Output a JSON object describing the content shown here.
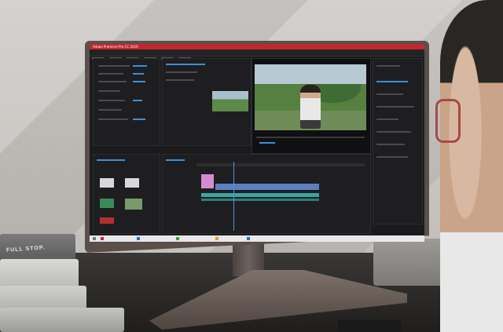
{
  "scene": {
    "description_label": "",
    "app": {
      "title": "Adobe Premiere Pro CC 2019",
      "panels": [
        "effects-controls",
        "source-monitor",
        "program-monitor",
        "effects-panel",
        "project",
        "timeline"
      ]
    },
    "book": {
      "cover_text": "FULL STOP."
    },
    "colors": {
      "titlebar": "#c2272d",
      "accent": "#3d8fd6",
      "clip_pink": "#d48bd0",
      "clip_teal": "#3ba5a0",
      "monitor_frame": "#5a4f4b"
    }
  }
}
